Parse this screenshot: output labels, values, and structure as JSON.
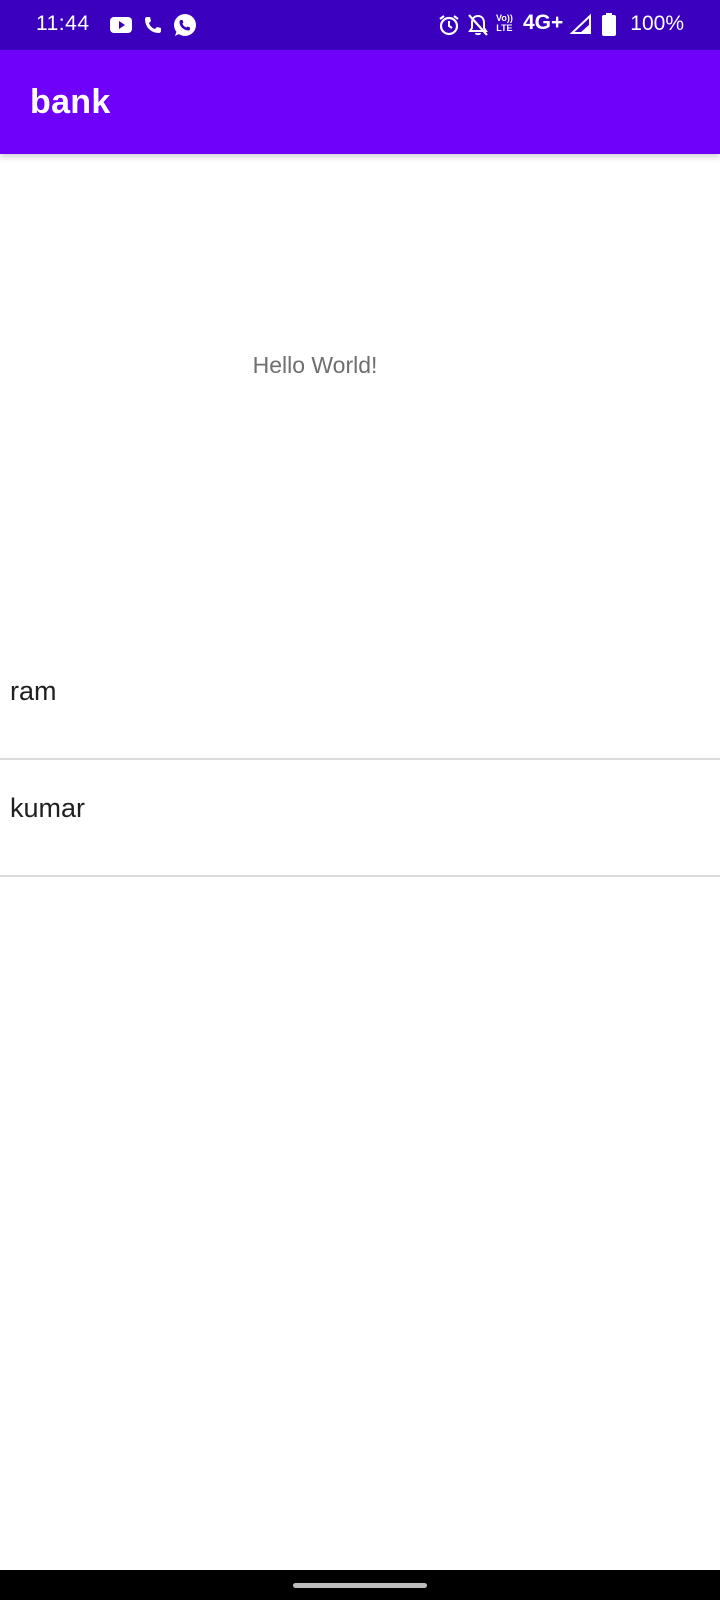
{
  "status_bar": {
    "time": "11:44",
    "left_icons": [
      "youtube-icon",
      "phone-icon",
      "whatsapp-icon"
    ],
    "right_icons": [
      "alarm-icon",
      "notifications-off-icon",
      "volte-icon",
      "network-type",
      "signal-icon",
      "battery-icon"
    ],
    "volte_top": "Vo))",
    "volte_bottom": "LTE",
    "network": "4G+",
    "battery": "100%",
    "color": "#3a00be"
  },
  "app_bar": {
    "title": "bank",
    "color": "#6f00fa"
  },
  "main": {
    "hello_text": "Hello World!"
  },
  "list": {
    "items": [
      {
        "label": "ram"
      },
      {
        "label": "kumar"
      }
    ]
  },
  "nav_bar": {
    "color": "#000000"
  }
}
